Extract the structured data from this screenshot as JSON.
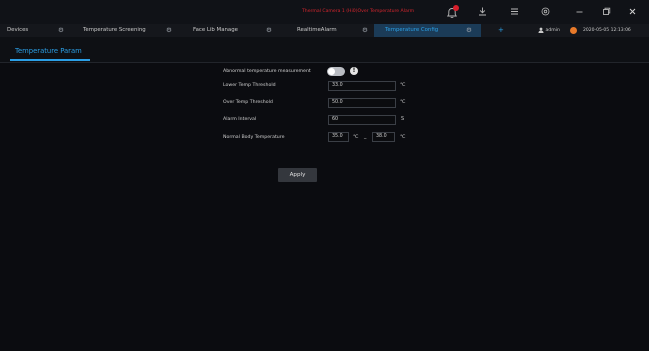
{
  "titlebar": {
    "alert_text": "Thermal Camera 1 (Hi0)Over Temperature Alarm",
    "icons": [
      "bell-icon",
      "download-icon",
      "menu-icon",
      "settings-icon",
      "minimize-icon",
      "restore-icon",
      "close-icon"
    ]
  },
  "tabs": [
    {
      "label": "Devices"
    },
    {
      "label": "Temperature Screening"
    },
    {
      "label": "Face Lib Manage"
    },
    {
      "label": "RealtimeAlarm"
    },
    {
      "label": "Temperature Config",
      "active": true
    }
  ],
  "user": {
    "name": "admin"
  },
  "datetime": "2020-05-05 12:13:06",
  "subtab": {
    "label": "Temperature Param"
  },
  "form": {
    "abnormal_label": "Abnormal temperature measurement",
    "lower_label": "Lower Temp Threshold",
    "lower_value": "33.0",
    "over_label": "Over Temp Threshold",
    "over_value": "50.0",
    "alarm_label": "Alarm Interval",
    "alarm_value": "60",
    "normal_label": "Normal Body Temperature",
    "normal_min": "35.0",
    "normal_max": "38.0",
    "unit_c": "℃",
    "unit_s": "S",
    "range_sep": "_"
  },
  "apply_label": "Apply",
  "colors": {
    "accent": "#2b9fe6",
    "alarm": "#d7262e",
    "background": "#0b0c10"
  }
}
